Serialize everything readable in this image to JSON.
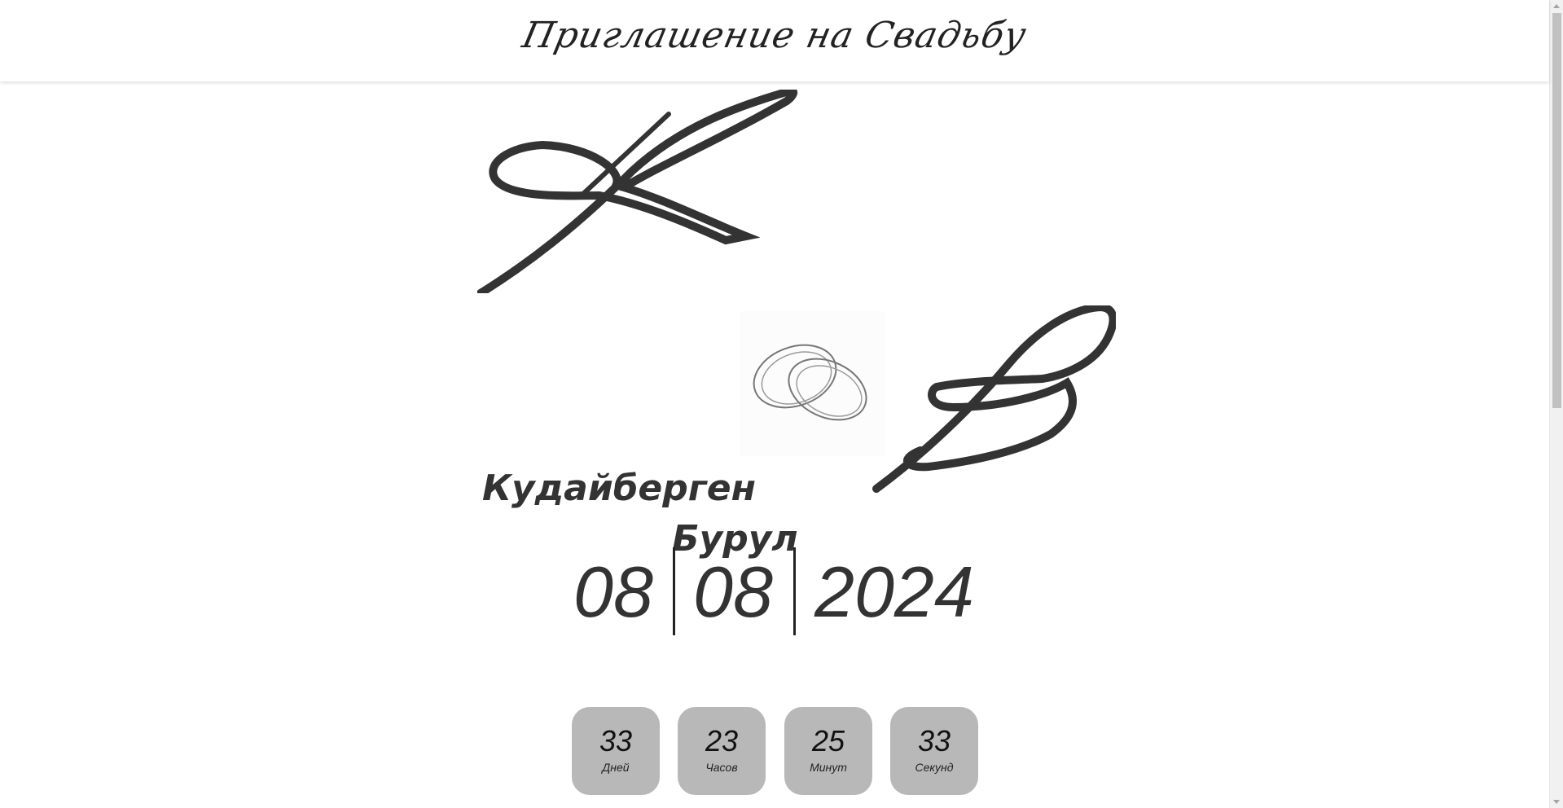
{
  "header": {
    "title": "Приглашение на Свадьбу"
  },
  "monograms": {
    "groom_initial_icon": "script-letter-k-icon",
    "bride_initial_icon": "script-letter-b-icon",
    "rings_icon": "wedding-rings-icon"
  },
  "couple": {
    "groom": "Кудайберген",
    "bride": "Бурул"
  },
  "date": {
    "day": "08",
    "month": "08",
    "year": "2024"
  },
  "countdown": [
    {
      "value": "33",
      "label": "Дней"
    },
    {
      "value": "23",
      "label": "Часов"
    },
    {
      "value": "25",
      "label": "Минут"
    },
    {
      "value": "33",
      "label": "Секунд"
    }
  ],
  "colors": {
    "text": "#333333",
    "countdown_bg": "#b8b8b8",
    "background": "#ffffff"
  }
}
